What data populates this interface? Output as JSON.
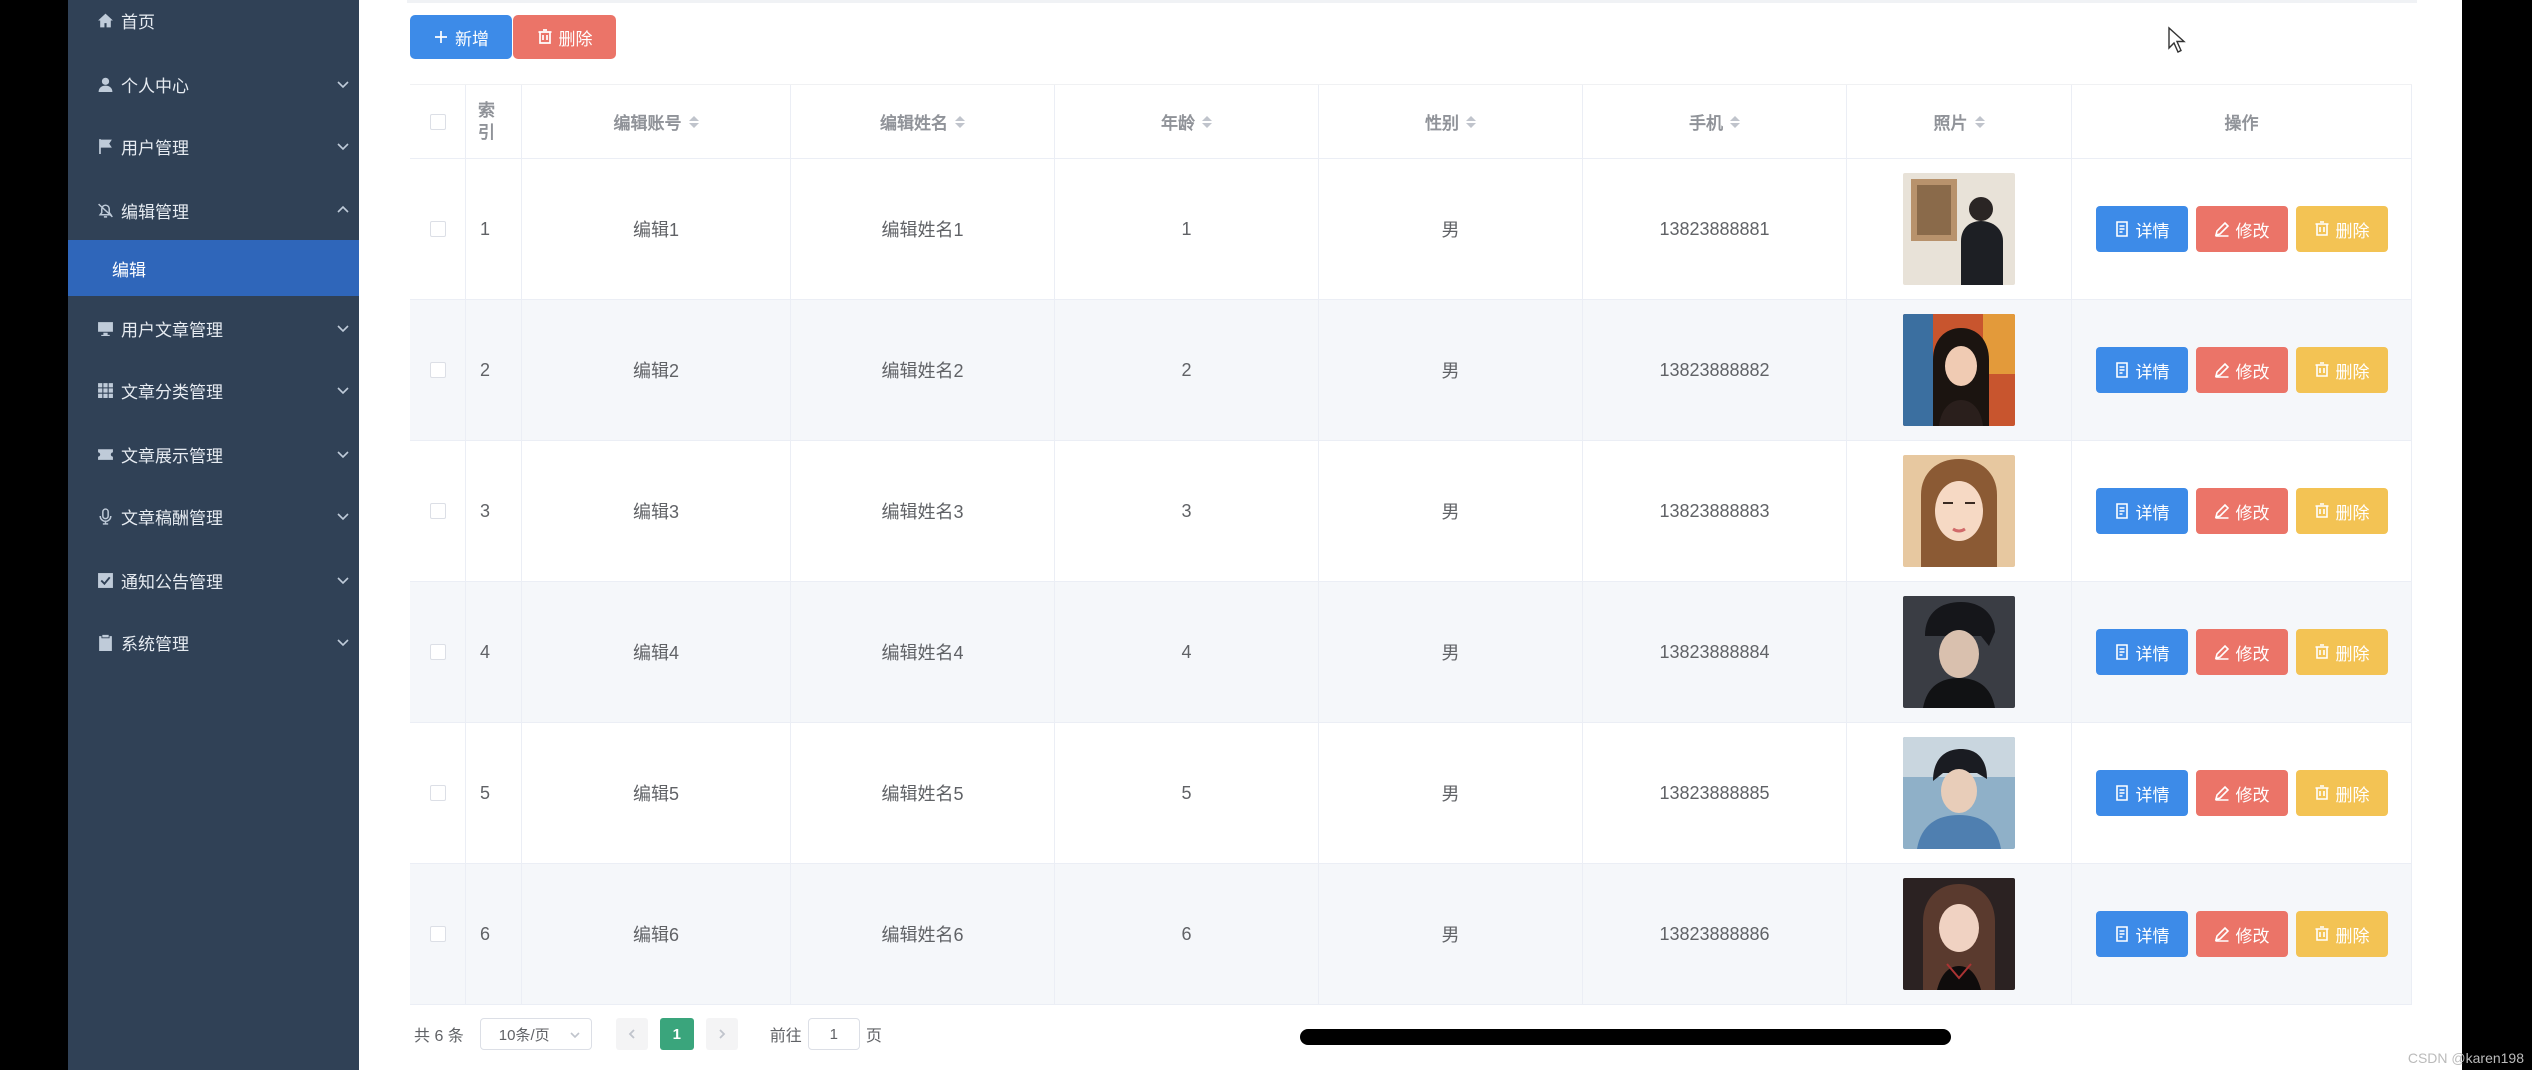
{
  "sidebar": {
    "items": [
      {
        "label": "首页",
        "icon": "home-icon"
      },
      {
        "label": "个人中心",
        "icon": "person-icon"
      },
      {
        "label": "用户管理",
        "icon": "flag-icon"
      },
      {
        "label": "编辑管理",
        "icon": "bell-icon"
      },
      {
        "label": "用户文章管理",
        "icon": "monitor-icon"
      },
      {
        "label": "文章分类管理",
        "icon": "grid-icon"
      },
      {
        "label": "文章展示管理",
        "icon": "ticket-icon"
      },
      {
        "label": "文章稿酬管理",
        "icon": "microphone-icon"
      },
      {
        "label": "通知公告管理",
        "icon": "checkbox-icon"
      },
      {
        "label": "系统管理",
        "icon": "clipboard-icon"
      }
    ],
    "active_sub": "编辑"
  },
  "toolbar": {
    "add_label": "新增",
    "delete_label": "删除"
  },
  "table": {
    "headers": {
      "index": "索引",
      "account": "编辑账号",
      "name": "编辑姓名",
      "age": "年龄",
      "gender": "性别",
      "phone": "手机",
      "photo": "照片",
      "actions": "操作"
    },
    "rows": [
      {
        "index": "1",
        "account": "编辑1",
        "name": "编辑姓名1",
        "age": "1",
        "gender": "男",
        "phone": "13823888881"
      },
      {
        "index": "2",
        "account": "编辑2",
        "name": "编辑姓名2",
        "age": "2",
        "gender": "男",
        "phone": "13823888882"
      },
      {
        "index": "3",
        "account": "编辑3",
        "name": "编辑姓名3",
        "age": "3",
        "gender": "男",
        "phone": "13823888883"
      },
      {
        "index": "4",
        "account": "编辑4",
        "name": "编辑姓名4",
        "age": "4",
        "gender": "男",
        "phone": "13823888884"
      },
      {
        "index": "5",
        "account": "编辑5",
        "name": "编辑姓名5",
        "age": "5",
        "gender": "男",
        "phone": "13823888885"
      },
      {
        "index": "6",
        "account": "编辑6",
        "name": "编辑姓名6",
        "age": "6",
        "gender": "男",
        "phone": "13823888886"
      }
    ],
    "row_actions": {
      "detail": "详情",
      "edit": "修改",
      "delete": "删除"
    }
  },
  "pagination": {
    "total_label": "共 6 条",
    "page_size": "10条/页",
    "current_page": "1",
    "goto_prefix": "前往",
    "goto_value": "1",
    "goto_suffix": "页"
  },
  "watermark": "CSDN @karen198",
  "colors": {
    "sidebar_bg": "#304156",
    "active_sub": "#2f66ba",
    "primary": "#3d8be8",
    "danger": "#eb7468",
    "warning": "#f3c354",
    "page_active": "#3aa57c"
  }
}
